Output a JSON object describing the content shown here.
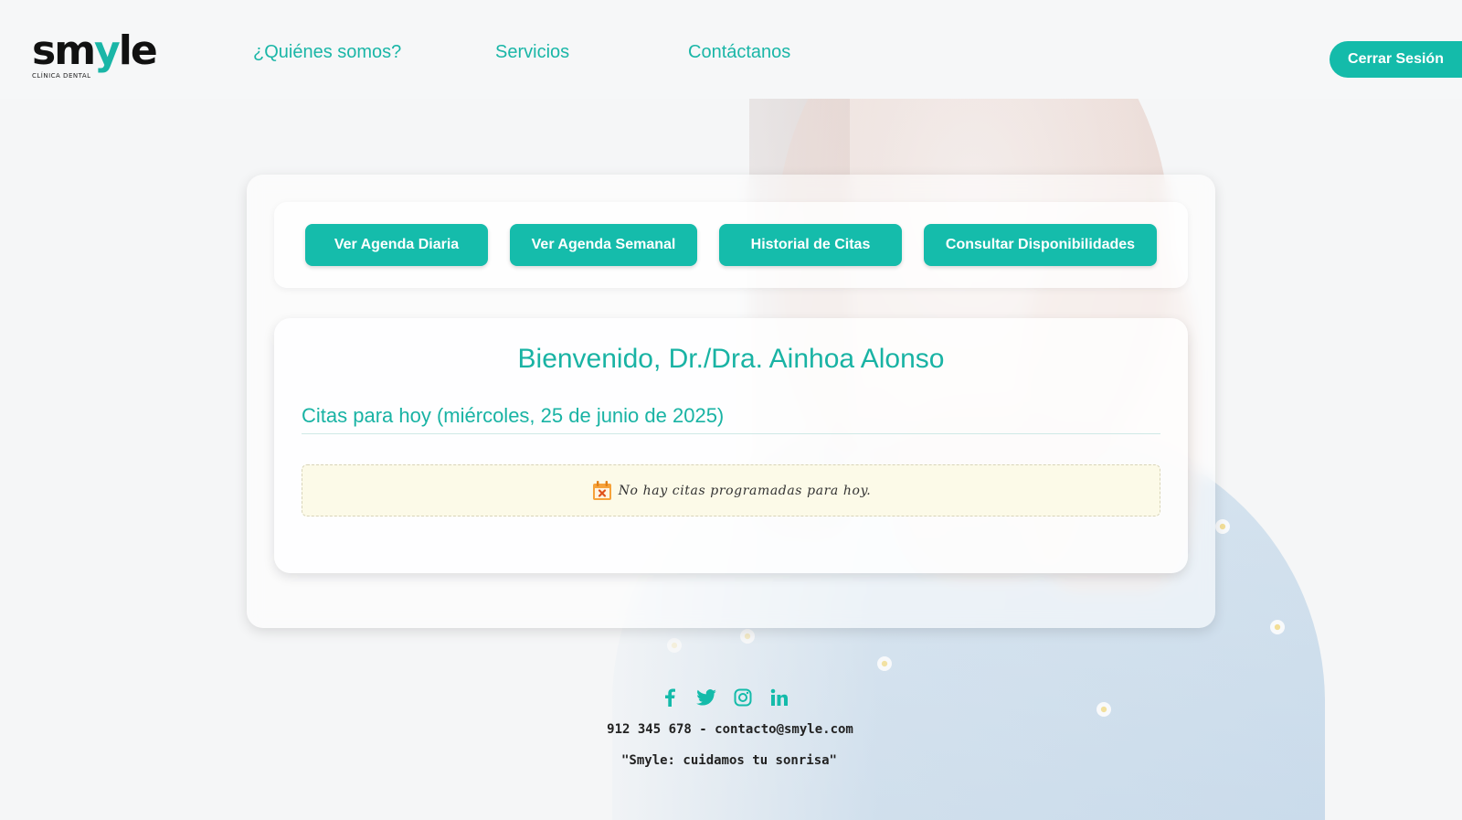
{
  "brand": {
    "logo_main": "sm",
    "logo_accent": "y",
    "logo_end": "le",
    "logo_sub": "CLÍNICA DENTAL",
    "accent_color": "#14bbaa"
  },
  "nav": {
    "items": [
      {
        "label": "¿Quiénes somos?"
      },
      {
        "label": "Servicios"
      },
      {
        "label": "Contáctanos"
      }
    ],
    "logout_label": "Cerrar Sesión"
  },
  "toolbar": {
    "buttons": [
      {
        "label": "Ver Agenda Diaria"
      },
      {
        "label": "Ver Agenda Semanal"
      },
      {
        "label": "Historial de Citas"
      },
      {
        "label": "Consultar Disponibilidades"
      }
    ]
  },
  "dashboard": {
    "welcome": "Bienvenido, Dr./Dra. Ainhoa Alonso",
    "appointments_heading": "Citas para hoy (miércoles, 25 de junio de 2025)",
    "empty_message": "No hay citas programadas para hoy.",
    "empty_icon": "calendar-x-icon"
  },
  "footer": {
    "social": [
      "facebook-icon",
      "twitter-icon",
      "instagram-icon",
      "linkedin-icon"
    ],
    "contact": "912 345 678 - contacto@smyle.com",
    "slogan": "\"Smyle: cuidamos tu sonrisa\""
  }
}
